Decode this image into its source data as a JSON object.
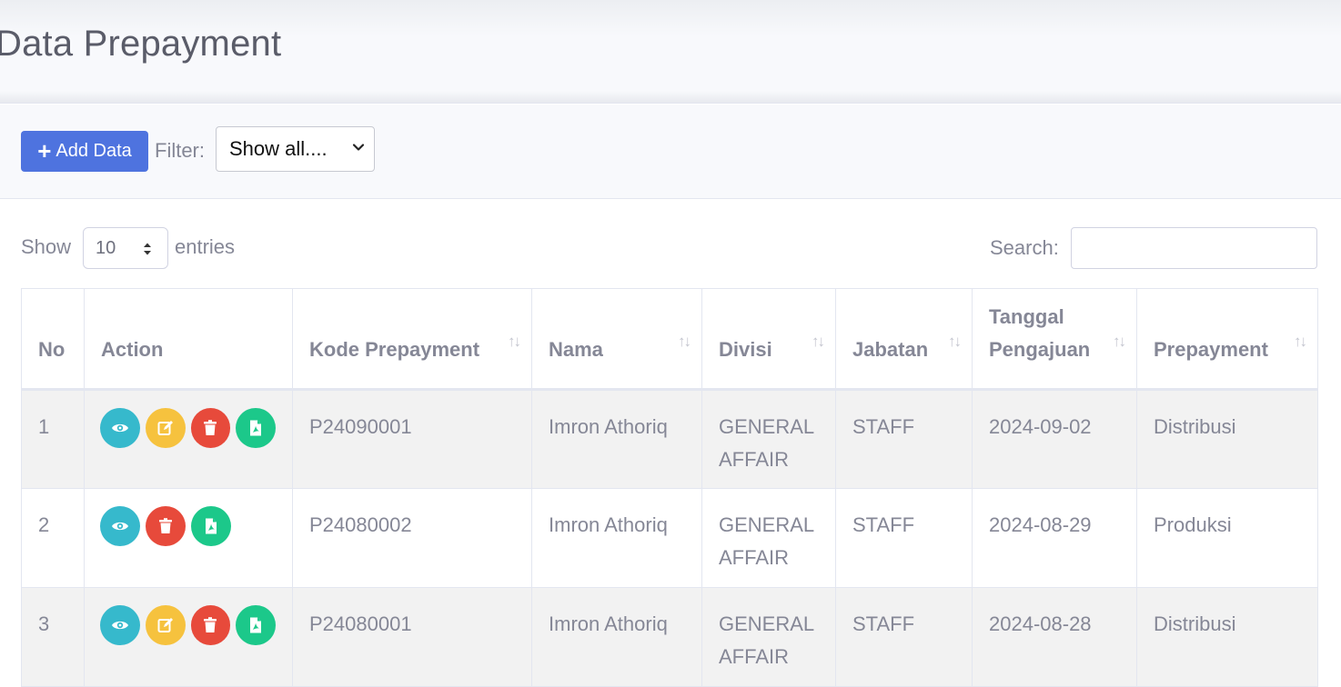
{
  "page": {
    "title": "Data Prepayment"
  },
  "toolbar": {
    "add_label": "Add Data",
    "filter_label": "Filter:",
    "filter_selected": "Show all...."
  },
  "table_controls": {
    "show_label": "Show",
    "entries_value": "10",
    "entries_label": "entries",
    "search_label": "Search:"
  },
  "table": {
    "columns": [
      "No",
      "Action",
      "Kode Prepayment",
      "Nama",
      "Divisi",
      "Jabatan",
      "Tanggal Pengajuan",
      "Prepayment"
    ],
    "rows": [
      {
        "no": "1",
        "kode": "P24090001",
        "nama": "Imron Athoriq",
        "divisi": "GENERAL AFFAIR",
        "jabatan": "STAFF",
        "tanggal": "2024-09-02",
        "prepayment": "Distribusi",
        "actions": [
          "eye-icon",
          "edit-icon",
          "trash-icon",
          "pdf-icon"
        ]
      },
      {
        "no": "2",
        "kode": "P24080002",
        "nama": "Imron Athoriq",
        "divisi": "GENERAL AFFAIR",
        "jabatan": "STAFF",
        "tanggal": "2024-08-29",
        "prepayment": "Produksi",
        "actions": [
          "eye-icon",
          "trash-icon",
          "pdf-icon"
        ]
      },
      {
        "no": "3",
        "kode": "P24080001",
        "nama": "Imron Athoriq",
        "divisi": "GENERAL AFFAIR",
        "jabatan": "STAFF",
        "tanggal": "2024-08-28",
        "prepayment": "Distribusi",
        "actions": [
          "eye-icon",
          "edit-icon",
          "trash-icon",
          "pdf-icon"
        ]
      }
    ]
  },
  "colors": {
    "primary": "#4e73df",
    "info": "#36b9cc",
    "warning": "#f6c23e",
    "danger": "#e74a3b",
    "success": "#1cc88a"
  }
}
